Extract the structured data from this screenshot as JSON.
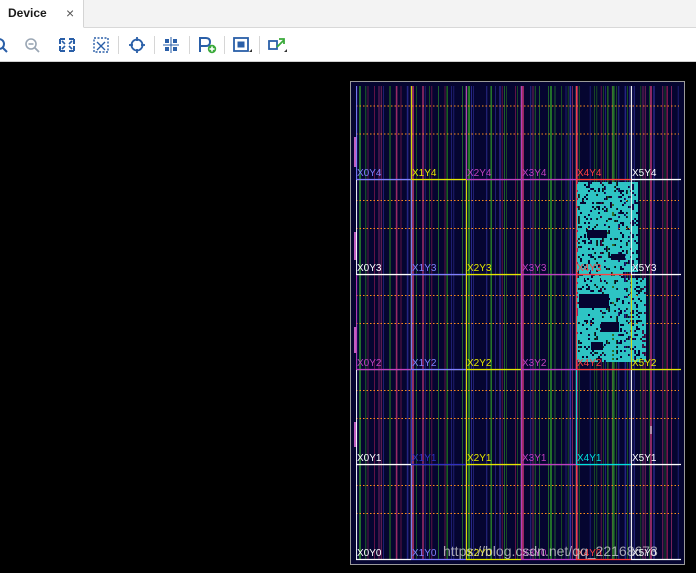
{
  "tab": {
    "label": "Device",
    "close": "×"
  },
  "toolbar": {
    "buttons": [
      {
        "name": "zoom-in-icon"
      },
      {
        "name": "zoom-out-icon"
      },
      {
        "name": "zoom-fit-icon"
      },
      {
        "name": "zoom-selected-icon"
      },
      {
        "name": "find-icon"
      },
      {
        "name": "routing-resources-icon"
      },
      {
        "name": "add-pblock-icon"
      },
      {
        "name": "pblock-select-icon"
      },
      {
        "name": "move-icon"
      }
    ]
  },
  "device": {
    "columns": [
      "X0",
      "X1",
      "X2",
      "X3",
      "X4",
      "X5"
    ],
    "rows": [
      "Y4",
      "Y3",
      "Y2",
      "Y1",
      "Y0"
    ],
    "region_labels": [
      {
        "text": "X0Y4",
        "color": "#8080ff"
      },
      {
        "text": "X1Y4",
        "color": "#e6e600"
      },
      {
        "text": "X2Y4",
        "color": "#c040c0"
      },
      {
        "text": "X3Y4",
        "color": "#c040c0"
      },
      {
        "text": "X4Y4",
        "color": "#ff4040"
      },
      {
        "text": "X5Y4",
        "color": "#ffffff"
      },
      {
        "text": "X0Y3",
        "color": "#ffffff"
      },
      {
        "text": "X1Y3",
        "color": "#8080ff"
      },
      {
        "text": "X2Y3",
        "color": "#e6e600"
      },
      {
        "text": "X3Y3",
        "color": "#c040c0"
      },
      {
        "text": "X4Y3",
        "color": "#ff4040"
      },
      {
        "text": "X5Y3",
        "color": "#ffffff"
      },
      {
        "text": "X0Y2",
        "color": "#c040c0"
      },
      {
        "text": "X1Y2",
        "color": "#8080ff"
      },
      {
        "text": "X2Y2",
        "color": "#e6e600"
      },
      {
        "text": "X3Y2",
        "color": "#c040c0"
      },
      {
        "text": "X4Y2",
        "color": "#ff4040"
      },
      {
        "text": "X5Y2",
        "color": "#e6e600"
      },
      {
        "text": "X0Y1",
        "color": "#ffffff"
      },
      {
        "text": "X1Y1",
        "color": "#3030c0"
      },
      {
        "text": "X2Y1",
        "color": "#e6e600"
      },
      {
        "text": "X3Y1",
        "color": "#c040c0"
      },
      {
        "text": "X4Y1",
        "color": "#00e0e0"
      },
      {
        "text": "X5Y1",
        "color": "#ffffff"
      },
      {
        "text": "X0Y0",
        "color": "#ffffff"
      },
      {
        "text": "X1Y0",
        "color": "#8080ff"
      },
      {
        "text": "X2Y0",
        "color": "#e6e600"
      },
      {
        "text": "X3Y0",
        "color": "#c040c0"
      },
      {
        "text": "X4Y0",
        "color": "#ff4040"
      },
      {
        "text": "X5Y0",
        "color": "#ffffff"
      }
    ],
    "colors": {
      "background": "#050530",
      "placed_cells": "#2ec4c4",
      "dsp_column": "#b03070",
      "bram_column": "#2a8a2a",
      "clock_row": "#ff8c1a",
      "grid_line": "#8a8a8a"
    }
  },
  "watermark": "https://blog.csdn.net/qq_22168673"
}
